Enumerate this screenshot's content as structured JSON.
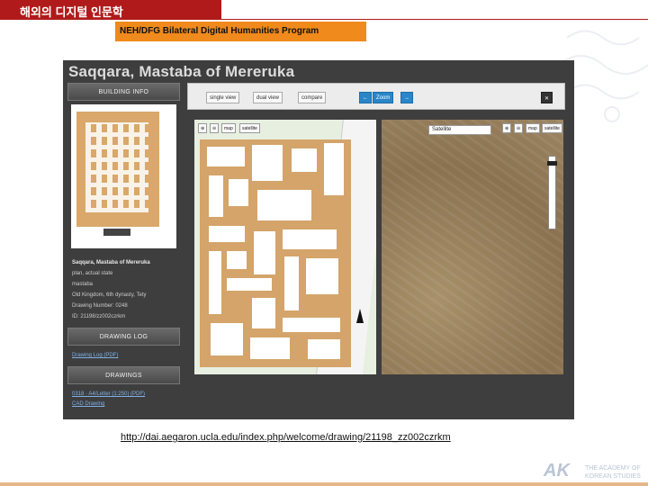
{
  "slide": {
    "title": "해외의 디지털 인문학",
    "subtitle": "NEH/DFG Bilateral Digital Humanities Program",
    "url": "http://dai.aegaron.ucla.edu/index.php/welcome/drawing/21198_zz002czrkm",
    "logo_mark": "AK",
    "logo_text_1": "THE ACADEMY OF",
    "logo_text_2": "KOREAN STUDIES"
  },
  "site": {
    "heading": "Saqqara, Mastaba of Mereruka",
    "left": {
      "building_info_label": "BUILDING INFO",
      "info_name": "Saqqara, Mastaba of Mereruka",
      "info_plan": "plan, actual state",
      "info_type": "mastaba",
      "info_period": "Old Kingdom, 6th dynasty, Tety",
      "info_number": "Drawing Number: 0248",
      "info_id": "ID: 21198/zz002czrkm",
      "drawing_log_label": "DRAWING LOG",
      "drawing_log_link": "Drawing Log (PDF)",
      "drawings_label": "DRAWINGS",
      "drawing_item": "0318 · A4/Letter (1:250) (PDF)",
      "cad_link": "CAD Drawing"
    },
    "toolbar": {
      "single_view": "single view",
      "dual_view": "dual view",
      "compare": "compare",
      "prev_icon": "←",
      "zoom_label": "Zoom",
      "next_icon": "→",
      "close_icon": "✕"
    },
    "map": {
      "zoom_in": "⊕",
      "zoom_out": "⊖",
      "map_label": "map",
      "satellite_label": "satellite",
      "satellite_select": "Satellite"
    }
  }
}
